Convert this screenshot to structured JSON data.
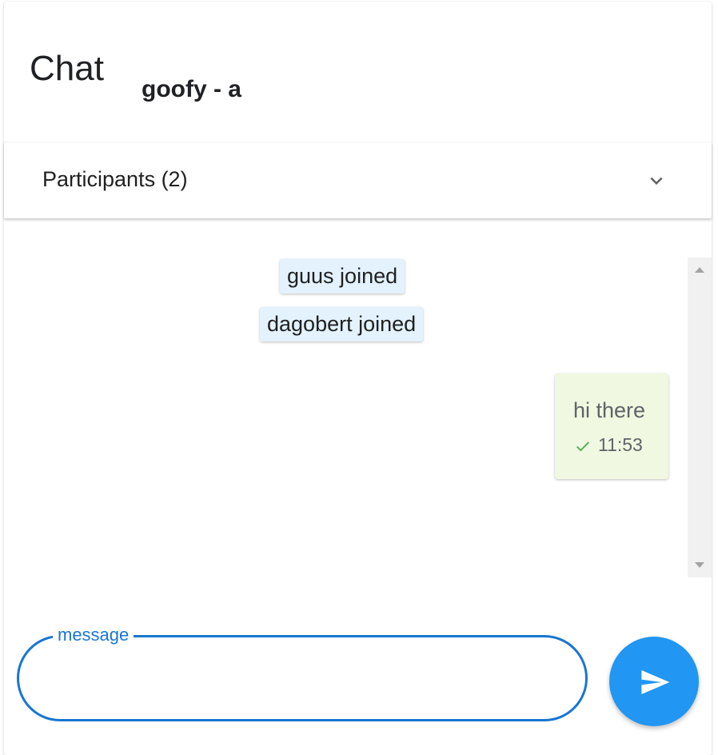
{
  "header": {
    "title": "Chat",
    "subtitle": "goofy - a"
  },
  "participants": {
    "label": "Participants (2)",
    "icon": "chevron-down-icon"
  },
  "messages": {
    "system": [
      {
        "text": "guus joined"
      },
      {
        "text": "dagobert joined"
      }
    ],
    "outgoing": [
      {
        "text": "hi there",
        "time": "11:53",
        "status_icon": "check-icon"
      }
    ]
  },
  "composer": {
    "label": "message",
    "value": "",
    "send_icon": "send-icon"
  },
  "colors": {
    "accent": "#1976d2",
    "send_button": "#2196f3",
    "system_bubble": "#e3f2fd",
    "own_bubble": "#f1f8e1",
    "check": "#4caf50"
  }
}
